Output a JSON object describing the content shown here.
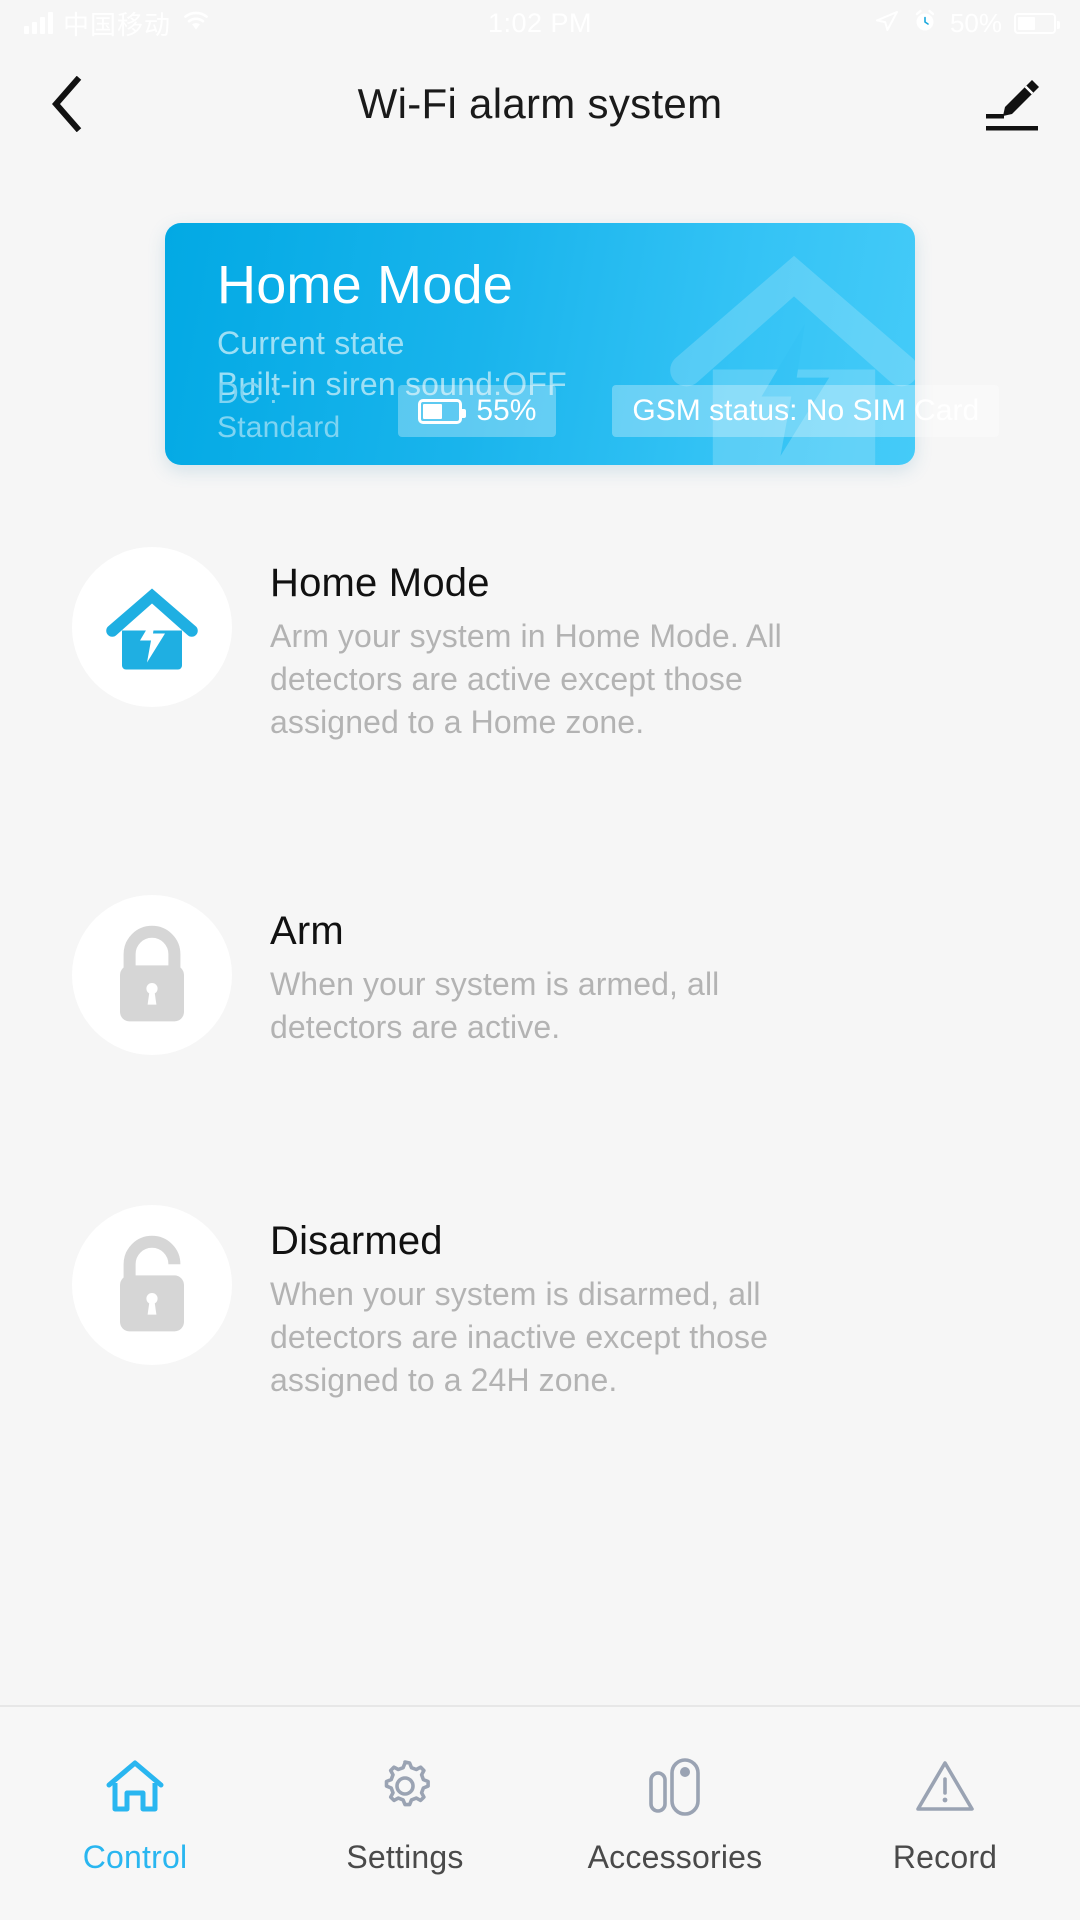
{
  "statusbar": {
    "carrier": "中国移动",
    "time": "1:02 PM",
    "battery_percent": "50%",
    "signal_icon": "signal-bars-icon",
    "wifi_icon": "wifi-icon",
    "location_icon": "location-arrow-icon",
    "alarm_icon": "alarm-clock-icon",
    "battery_icon": "battery-icon"
  },
  "header": {
    "title": "Wi-Fi alarm system",
    "back_icon": "back-chevron-icon",
    "edit_icon": "edit-pencil-icon"
  },
  "hero": {
    "title": "Home Mode",
    "current_state_label": "Current state",
    "siren_label": "Built-in siren sound:OFF",
    "dc_label": "DC : Standard",
    "battery_percent": "55%",
    "gsm_status": "GSM status: No SIM Card",
    "gradient_from": "#02a9e4",
    "gradient_to": "#45cbf8",
    "deco_icon": "house-bolt-icon"
  },
  "modes": [
    {
      "title": "Home Mode",
      "desc": "Arm your system in Home Mode. All detectors are active except those assigned to a Home zone.",
      "icon": "house-bolt-icon",
      "icon_color": "#1fafe2",
      "active": true
    },
    {
      "title": "Arm",
      "desc": "When your system is armed, all detectors are active.",
      "icon": "lock-closed-icon",
      "icon_color": "#d6d6d6",
      "active": false
    },
    {
      "title": "Disarmed",
      "desc": "When your system is disarmed, all detectors are inactive except those assigned to a 24H zone.",
      "icon": "lock-open-icon",
      "icon_color": "#d6d6d6",
      "active": false
    }
  ],
  "tabs": [
    {
      "label": "Control",
      "icon": "home-outline-icon",
      "active": true
    },
    {
      "label": "Settings",
      "icon": "gear-icon",
      "active": false
    },
    {
      "label": "Accessories",
      "icon": "door-sensor-icon",
      "active": false
    },
    {
      "label": "Record",
      "icon": "warning-triangle-icon",
      "active": false
    }
  ],
  "colors": {
    "accent": "#29b6f0",
    "background": "#f6f6f6",
    "title_text": "#111111",
    "muted_text": "#b3b3b3"
  }
}
